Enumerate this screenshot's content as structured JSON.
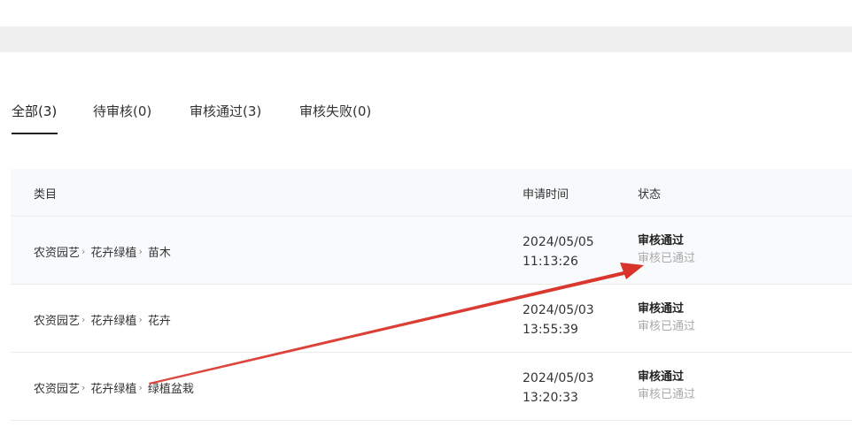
{
  "tabs": [
    {
      "label": "全部(3)",
      "active": true
    },
    {
      "label": "待审核(0)",
      "active": false
    },
    {
      "label": "审核通过(3)",
      "active": false
    },
    {
      "label": "审核失败(0)",
      "active": false
    }
  ],
  "table": {
    "headers": {
      "category": "类目",
      "time": "申请时间",
      "status": "状态"
    },
    "rows": [
      {
        "path": [
          "农资园艺",
          "花卉绿植",
          "苗木"
        ],
        "date": "2024/05/05",
        "clock": "11:13:26",
        "status": "审核通过",
        "status_sub": "审核已通过"
      },
      {
        "path": [
          "农资园艺",
          "花卉绿植",
          "花卉"
        ],
        "date": "2024/05/03",
        "clock": "13:55:39",
        "status": "审核通过",
        "status_sub": "审核已通过"
      },
      {
        "path": [
          "农资园艺",
          "花卉绿植",
          "绿植盆栽"
        ],
        "date": "2024/05/03",
        "clock": "13:20:33",
        "status": "审核通过",
        "status_sub": "审核已通过"
      }
    ]
  },
  "colors": {
    "arrow": "#d9342b",
    "accent_text": "#222222",
    "muted_text": "#aaaaaa"
  }
}
